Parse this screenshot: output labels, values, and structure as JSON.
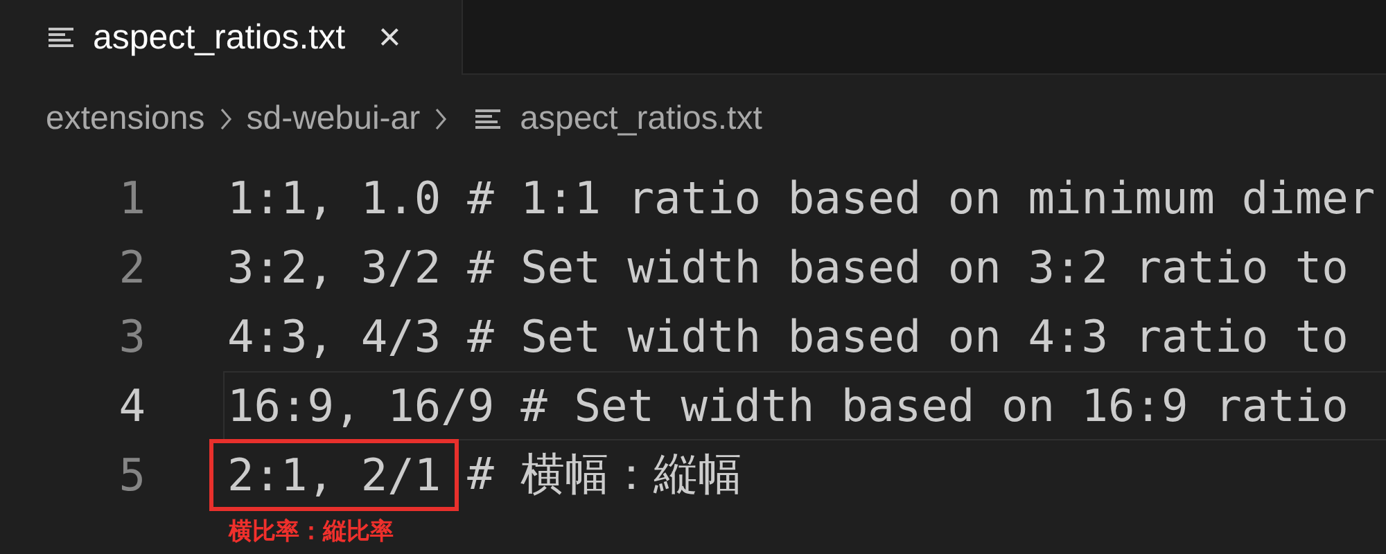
{
  "tabs": [
    {
      "label": "aspect_ratios.txt",
      "selected": true,
      "close": "×"
    }
  ],
  "breadcrumb": [
    {
      "label": "extensions",
      "kind": "folder"
    },
    {
      "label": "sd-webui-ar",
      "kind": "folder"
    },
    {
      "label": "aspect_ratios.txt",
      "kind": "file"
    }
  ],
  "lines": [
    {
      "number": "1",
      "code": "1:1, 1.0",
      "comment": "# 1:1 ratio based on minimum dimer",
      "current": false,
      "boxed": false
    },
    {
      "number": "2",
      "code": "3:2, 3/2",
      "comment": "# Set width based on 3:2 ratio to",
      "current": false,
      "boxed": false
    },
    {
      "number": "3",
      "code": "4:3, 4/3",
      "comment": "# Set width based on 4:3 ratio to",
      "current": false,
      "boxed": false
    },
    {
      "number": "4",
      "code": "16:9, 16/9",
      "comment": "# Set width based on 16:9 ratio",
      "current": true,
      "boxed": false
    },
    {
      "number": "5",
      "code": "2:1, 2/1",
      "comment": "# 横幅：縦幅",
      "current": false,
      "boxed": true,
      "annotation": "横比率：縦比率"
    }
  ]
}
